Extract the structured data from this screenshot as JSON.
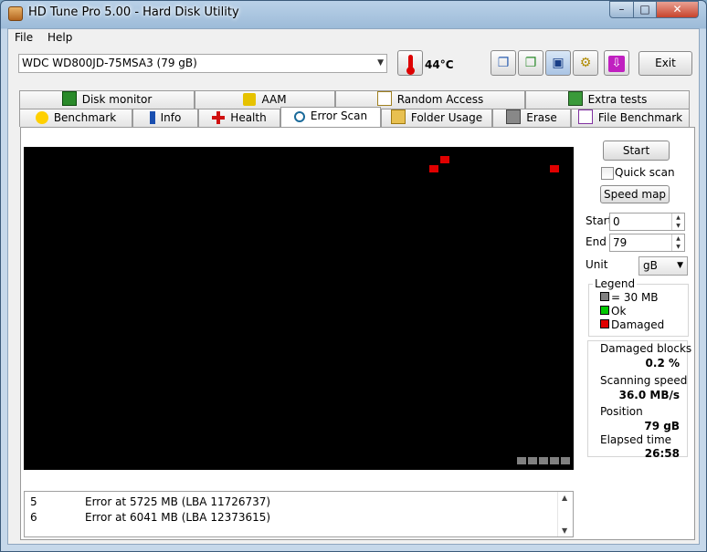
{
  "window": {
    "title": "HD Tune Pro 5.00 - Hard Disk Utility",
    "minimize_glyph": "–",
    "maximize_glyph": "□",
    "close_glyph": "✕"
  },
  "menu": {
    "file": "File",
    "help": "Help"
  },
  "toolbar": {
    "drive": "WDC WD800JD-75MSA3 (79 gB)",
    "temperature": "44°C",
    "exit_label": "Exit",
    "icons": [
      "copy-text-icon",
      "copy-screenshot-icon",
      "save-icon",
      "options-icon",
      "download-icon"
    ]
  },
  "tabs_top": [
    {
      "label": "Disk monitor",
      "icon": "disk-monitor-icon"
    },
    {
      "label": "AAM",
      "icon": "speaker-icon"
    },
    {
      "label": "Random Access",
      "icon": "random-access-icon"
    },
    {
      "label": "Extra tests",
      "icon": "extra-tests-icon"
    }
  ],
  "tabs_bottom": [
    {
      "label": "Benchmark",
      "icon": "lightbulb-icon"
    },
    {
      "label": "Info",
      "icon": "info-icon"
    },
    {
      "label": "Health",
      "icon": "health-cross-icon"
    },
    {
      "label": "Error Scan",
      "icon": "magnifier-icon",
      "active": true
    },
    {
      "label": "Folder Usage",
      "icon": "folder-icon"
    },
    {
      "label": "Erase",
      "icon": "trash-icon"
    },
    {
      "label": "File Benchmark",
      "icon": "file-benchmark-icon"
    }
  ],
  "scan": {
    "grid_columns": 50,
    "grid_rows": 35,
    "damaged_blocks_cells": [
      [
        38,
        1
      ],
      [
        37,
        2
      ],
      [
        48,
        2
      ]
    ],
    "unscanned_cells_last_row": [
      45,
      46,
      47,
      48,
      49
    ]
  },
  "log": [
    {
      "n": "5",
      "text": "Error at 5725 MB (LBA 11726737)"
    },
    {
      "n": "6",
      "text": "Error at 6041 MB (LBA 12373615)"
    }
  ],
  "controls": {
    "start_label": "Start",
    "quick_scan_label": "Quick scan",
    "speed_map_label": "Speed map",
    "start_field_label": "Start",
    "start_value": "0",
    "end_field_label": "End",
    "end_value": "79",
    "unit_label": "Unit",
    "unit_value": "gB"
  },
  "legend": {
    "title": "Legend",
    "block_size": "= 30 MB",
    "ok": "Ok",
    "damaged": "Damaged",
    "colors": {
      "unscanned": "#808080",
      "ok": "#00c800",
      "damaged": "#e00000"
    }
  },
  "stats": {
    "damaged_blocks_label": "Damaged blocks",
    "damaged_blocks_value": "0.2 %",
    "scanning_speed_label": "Scanning speed",
    "scanning_speed_value": "36.0 MB/s",
    "position_label": "Position",
    "position_value": "79 gB",
    "elapsed_label": "Elapsed time",
    "elapsed_value": "26:58"
  }
}
